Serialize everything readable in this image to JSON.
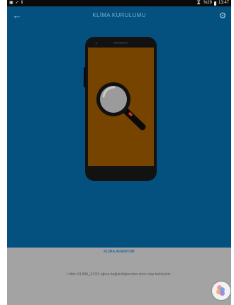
{
  "status_bar": {
    "left_icons": [
      "gallery-icon",
      "check-icon",
      "pause-icon"
    ],
    "signal_text": "%29",
    "time": "13:47"
  },
  "app_bar": {
    "title": "KLİMA KURULUMU"
  },
  "search": {
    "status": "KLIMA ARANIYOR",
    "instruction": "Lütfen KLIMA_XXXX ağına bağlandığınızdan emin olup bekleyiniz."
  },
  "colors": {
    "app_background": "#04507e",
    "screen_fill": "#774400",
    "panel_background": "#a3a3a3",
    "accent_red": "#c0392b"
  }
}
